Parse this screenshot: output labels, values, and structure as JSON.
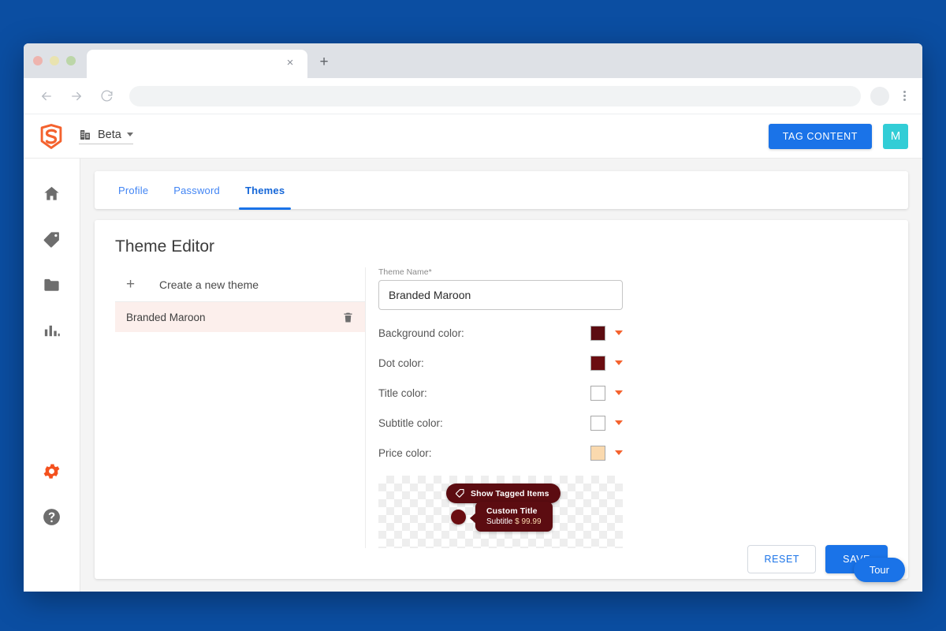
{
  "browser": {
    "tab_close_label": "×",
    "tab_new_label": "+",
    "back_icon": "arrow-left-icon",
    "forward_icon": "arrow-right-icon",
    "reload_icon": "reload-icon",
    "address_value": "",
    "address_placeholder": ""
  },
  "appbar": {
    "logo_icon": "snaplytics-s-logo",
    "building_icon": "building-icon",
    "workspace_name": "Beta",
    "tag_content_label": "TAG CONTENT",
    "avatar_initial": "M",
    "avatar_color": "#32cdd6",
    "primary_color": "#1a73e8"
  },
  "sidebar": {
    "items": [
      {
        "name": "home",
        "icon": "home-icon",
        "active": false
      },
      {
        "name": "tags",
        "icon": "tag-icon",
        "active": false
      },
      {
        "name": "folders",
        "icon": "folder-icon",
        "active": false
      },
      {
        "name": "analytics",
        "icon": "bar-chart-icon",
        "active": false
      },
      {
        "name": "settings",
        "icon": "gear-icon",
        "active": true
      },
      {
        "name": "help",
        "icon": "help-circle-icon",
        "active": false
      }
    ],
    "active_color": "#f4511e",
    "inactive_color": "#6d6d6d"
  },
  "tabs": [
    {
      "label": "Profile",
      "active": false
    },
    {
      "label": "Password",
      "active": false
    },
    {
      "label": "Themes",
      "active": true
    }
  ],
  "editor": {
    "title": "Theme Editor",
    "create_new_label": "Create a new theme",
    "create_new_icon": "plus-icon",
    "theme_list": [
      {
        "name": "Branded Maroon",
        "selected": true,
        "delete_icon": "trash-icon"
      }
    ],
    "name_field": {
      "label": "Theme Name",
      "required_mark": "*",
      "value": "Branded Maroon",
      "placeholder": "Theme Name"
    },
    "colors": [
      {
        "label": "Background color:",
        "value": "#5c0c11"
      },
      {
        "label": "Dot color:",
        "value": "#6b0d11"
      },
      {
        "label": "Title color:",
        "value": "#ffffff"
      },
      {
        "label": "Subtitle color:",
        "value": "#ffffff"
      },
      {
        "label": "Price color:",
        "value": "#fad9ae"
      }
    ],
    "dropdown_caret_color": "#f4622e",
    "preview": {
      "pill_label": "Show Tagged Items",
      "pill_icon": "tag-outline-icon",
      "tooltip_title": "Custom Title",
      "tooltip_subtitle": "Subtitle",
      "tooltip_price": "$ 99.99"
    },
    "reset_label": "RESET",
    "save_label": "SAVE"
  },
  "tour": {
    "label": "Tour"
  }
}
